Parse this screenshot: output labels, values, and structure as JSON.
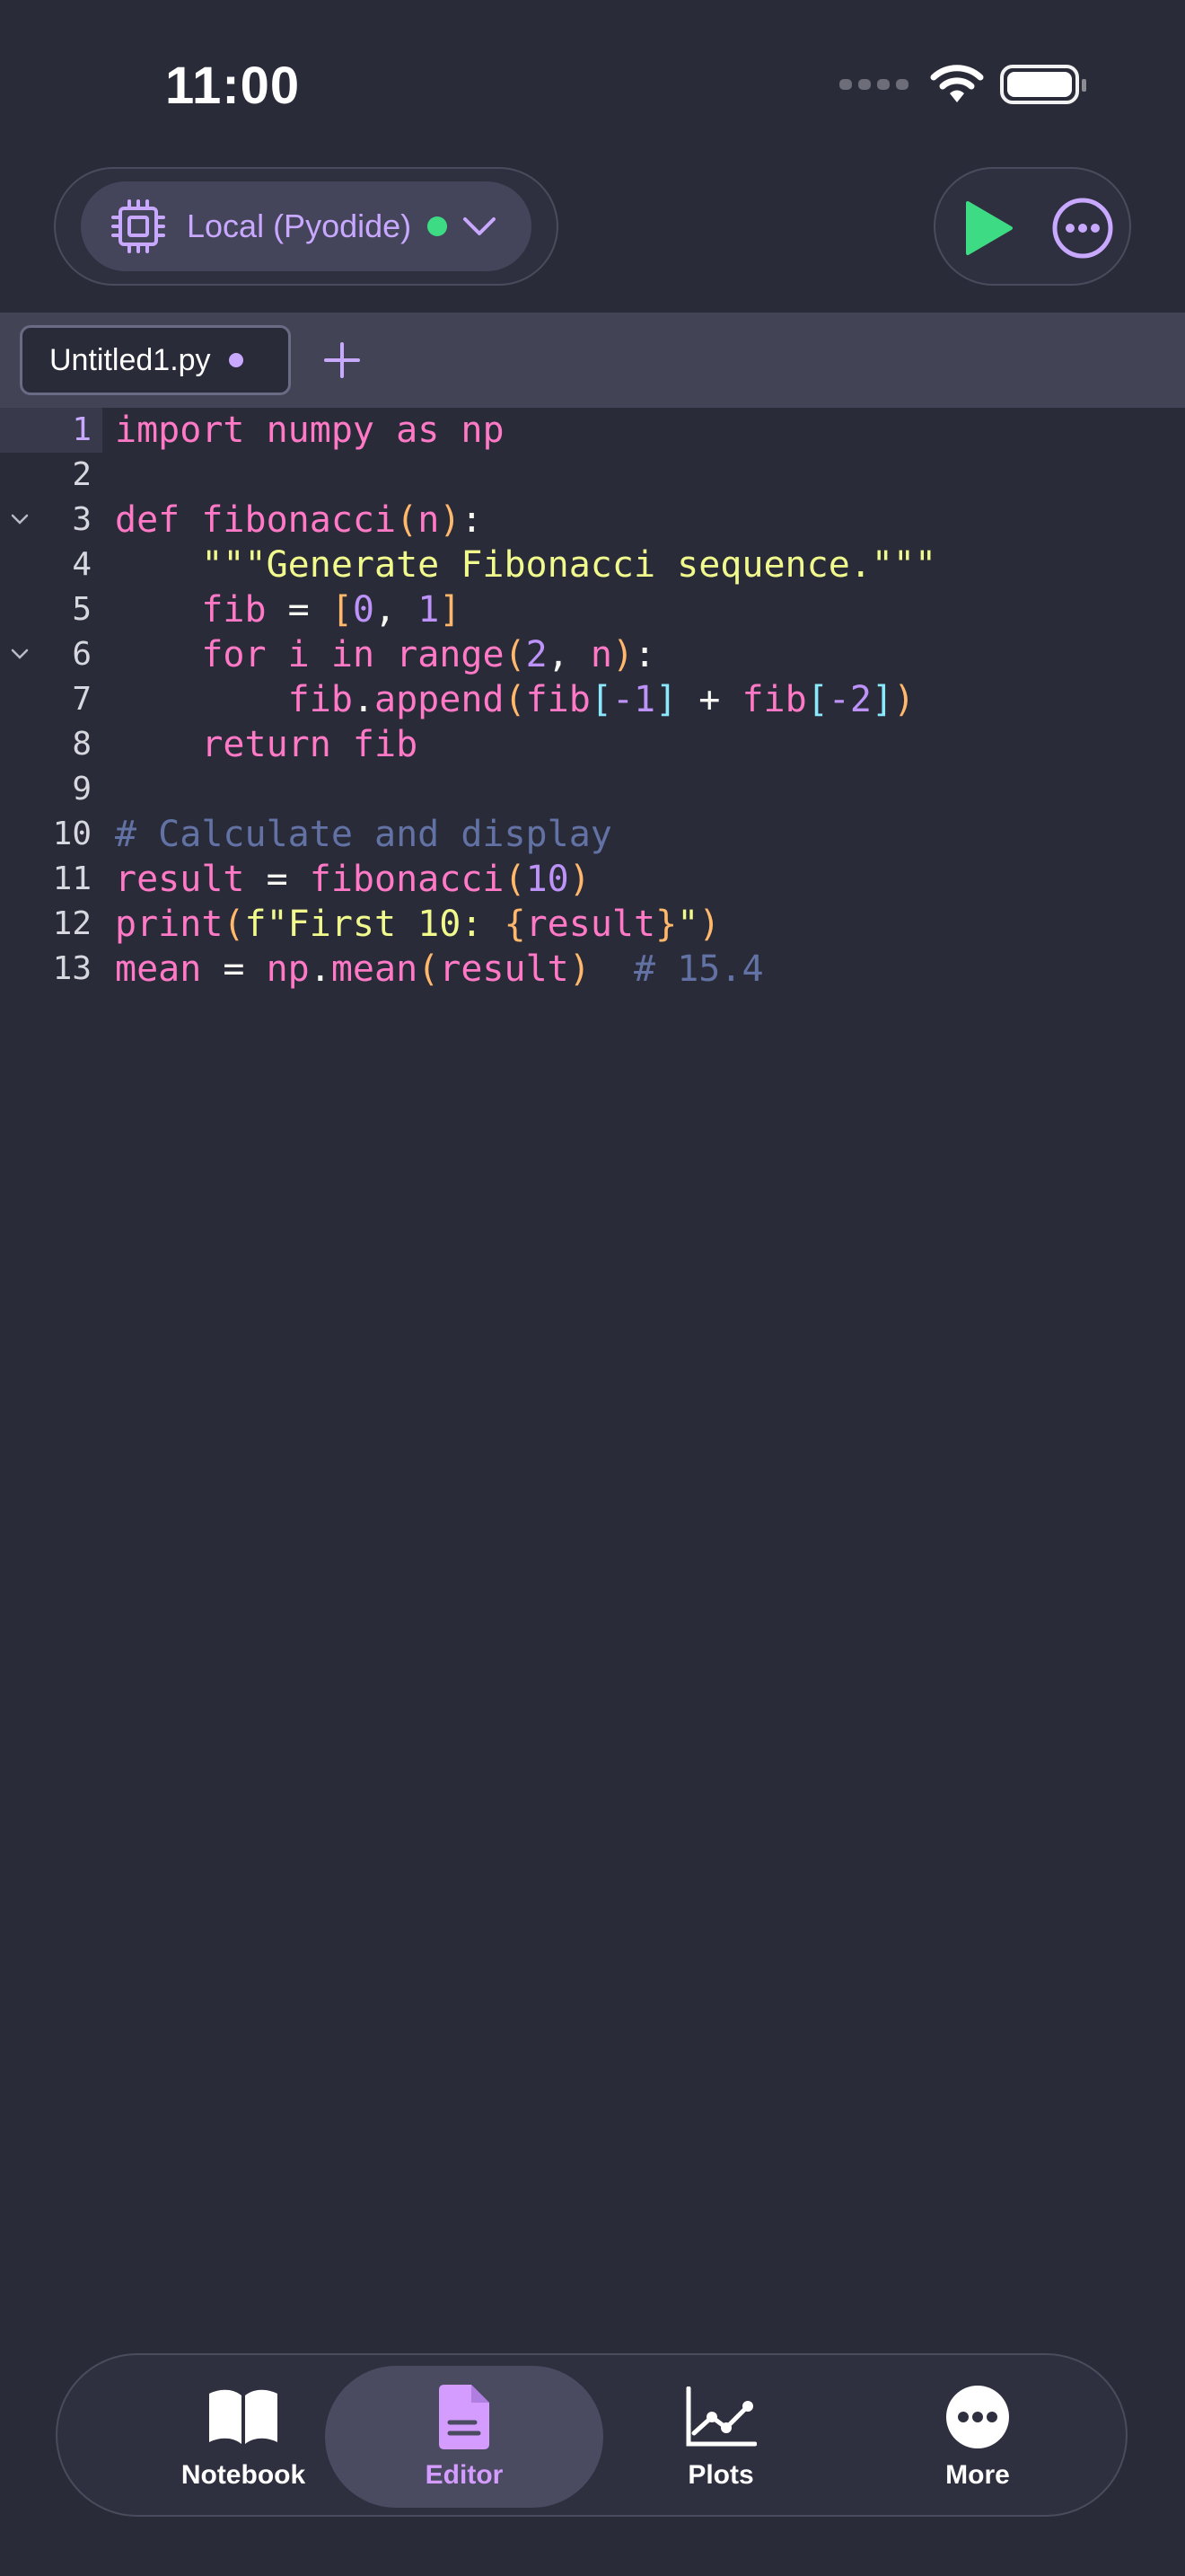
{
  "status_bar": {
    "time": "11:00"
  },
  "toolbar": {
    "runtime_label": "Local (Pyodide)",
    "runtime_status_color": "#3ddc84"
  },
  "tabs": [
    {
      "name": "Untitled1.py",
      "unsaved": true
    }
  ],
  "editor": {
    "active_line": 1,
    "lines": [
      {
        "number": "1",
        "foldable": false
      },
      {
        "number": "2",
        "foldable": false
      },
      {
        "number": "3",
        "foldable": true
      },
      {
        "number": "4",
        "foldable": false
      },
      {
        "number": "5",
        "foldable": false
      },
      {
        "number": "6",
        "foldable": true
      },
      {
        "number": "7",
        "foldable": false
      },
      {
        "number": "8",
        "foldable": false
      },
      {
        "number": "9",
        "foldable": false
      },
      {
        "number": "10",
        "foldable": false
      },
      {
        "number": "11",
        "foldable": false
      },
      {
        "number": "12",
        "foldable": false
      },
      {
        "number": "13",
        "foldable": false
      }
    ],
    "code": [
      [
        [
          "kw",
          "import"
        ],
        [
          "op",
          " "
        ],
        [
          "id",
          "numpy"
        ],
        [
          "op",
          " "
        ],
        [
          "kw",
          "as"
        ],
        [
          "op",
          " "
        ],
        [
          "id",
          "np"
        ]
      ],
      [],
      [
        [
          "kw",
          "def"
        ],
        [
          "op",
          " "
        ],
        [
          "id",
          "fibonacci"
        ],
        [
          "br1",
          "("
        ],
        [
          "id",
          "n"
        ],
        [
          "br1",
          ")"
        ],
        [
          "op",
          ":"
        ]
      ],
      [
        [
          "op",
          "    "
        ],
        [
          "str",
          "\"\"\"Generate Fibonacci sequence.\"\"\""
        ]
      ],
      [
        [
          "op",
          "    "
        ],
        [
          "id",
          "fib"
        ],
        [
          "op",
          " = "
        ],
        [
          "br1",
          "["
        ],
        [
          "num",
          "0"
        ],
        [
          "op",
          ", "
        ],
        [
          "num",
          "1"
        ],
        [
          "br1",
          "]"
        ]
      ],
      [
        [
          "op",
          "    "
        ],
        [
          "kw",
          "for"
        ],
        [
          "op",
          " "
        ],
        [
          "id",
          "i"
        ],
        [
          "op",
          " "
        ],
        [
          "kw",
          "in"
        ],
        [
          "op",
          " "
        ],
        [
          "id",
          "range"
        ],
        [
          "br1",
          "("
        ],
        [
          "num",
          "2"
        ],
        [
          "op",
          ", "
        ],
        [
          "id",
          "n"
        ],
        [
          "br1",
          ")"
        ],
        [
          "op",
          ":"
        ]
      ],
      [
        [
          "op",
          "        "
        ],
        [
          "id",
          "fib"
        ],
        [
          "op",
          "."
        ],
        [
          "id",
          "append"
        ],
        [
          "br1",
          "("
        ],
        [
          "id",
          "fib"
        ],
        [
          "br2",
          "["
        ],
        [
          "num",
          "-1"
        ],
        [
          "br2",
          "]"
        ],
        [
          "op",
          " + "
        ],
        [
          "id",
          "fib"
        ],
        [
          "br2",
          "["
        ],
        [
          "num",
          "-2"
        ],
        [
          "br2",
          "]"
        ],
        [
          "br1",
          ")"
        ]
      ],
      [
        [
          "op",
          "    "
        ],
        [
          "kw",
          "return"
        ],
        [
          "op",
          " "
        ],
        [
          "id",
          "fib"
        ]
      ],
      [],
      [
        [
          "cm",
          "# Calculate and display"
        ]
      ],
      [
        [
          "id",
          "result"
        ],
        [
          "op",
          " = "
        ],
        [
          "id",
          "fibonacci"
        ],
        [
          "br1",
          "("
        ],
        [
          "num",
          "10"
        ],
        [
          "br1",
          ")"
        ]
      ],
      [
        [
          "id",
          "print"
        ],
        [
          "br1",
          "("
        ],
        [
          "str",
          "f\"First 10: "
        ],
        [
          "br1",
          "{"
        ],
        [
          "id",
          "result"
        ],
        [
          "br1",
          "}"
        ],
        [
          "str",
          "\""
        ],
        [
          "br1",
          ")"
        ]
      ],
      [
        [
          "id",
          "mean"
        ],
        [
          "op",
          " = "
        ],
        [
          "id",
          "np"
        ],
        [
          "op",
          "."
        ],
        [
          "id",
          "mean"
        ],
        [
          "br1",
          "("
        ],
        [
          "id",
          "result"
        ],
        [
          "br1",
          ")"
        ],
        [
          "op",
          "  "
        ],
        [
          "cm",
          "# 15.4"
        ]
      ]
    ]
  },
  "bottom_nav": {
    "items": [
      {
        "label": "Notebook",
        "icon": "book-icon"
      },
      {
        "label": "Editor",
        "icon": "document-icon",
        "selected": true
      },
      {
        "label": "Plots",
        "icon": "line-chart-icon"
      },
      {
        "label": "More",
        "icon": "more-icon"
      }
    ]
  },
  "colors": {
    "background": "#2a2b38",
    "accent": "#c9a8ff",
    "run_green": "#3ddc84"
  }
}
